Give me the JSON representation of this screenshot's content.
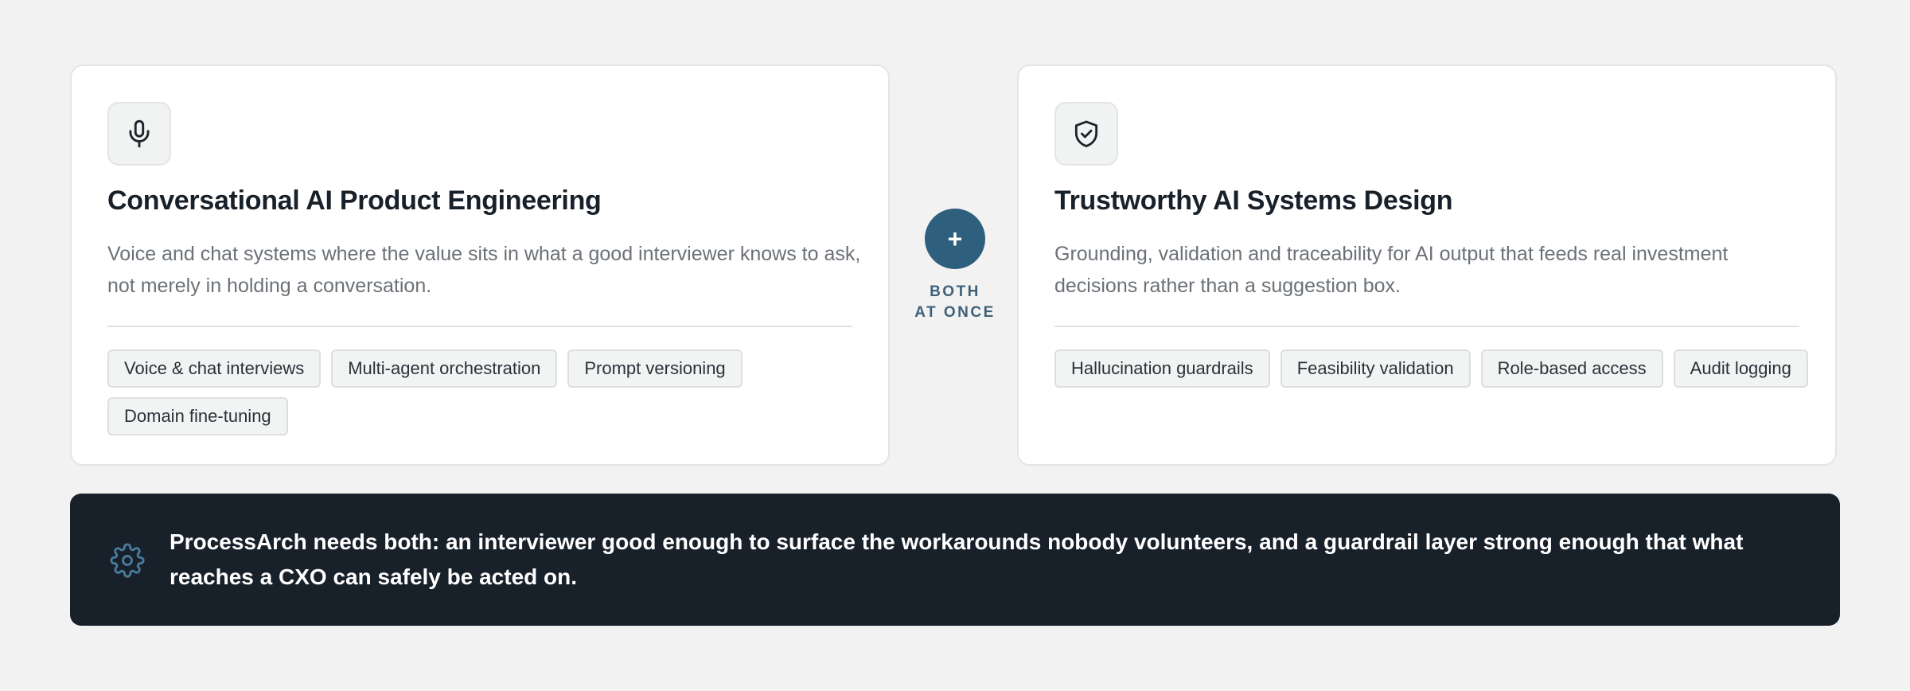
{
  "cards": [
    {
      "icon": "microphone-icon",
      "title": "Conversational AI Product Engineering",
      "description": "Voice and chat systems where the value sits in what a good interviewer knows to ask, not merely in holding a conversation.",
      "tags": [
        "Voice & chat interviews",
        "Multi-agent orchestration",
        "Prompt versioning",
        "Domain fine-tuning"
      ]
    },
    {
      "icon": "shield-check-icon",
      "title": "Trustworthy AI Systems Design",
      "description": "Grounding, validation and traceability for AI output that feeds real investment decisions rather than a suggestion box.",
      "tags": [
        "Hallucination guardrails",
        "Feasibility validation",
        "Role-based access",
        "Audit logging"
      ]
    }
  ],
  "connector": {
    "symbol": "+",
    "label_line1": "BOTH",
    "label_line2": "AT ONCE"
  },
  "banner": {
    "icon": "gear-icon",
    "text": "ProcessArch needs both: an interviewer good enough to surface the workarounds nobody volunteers, and a guardrail layer strong enough that what reaches a CXO can safely be acted on."
  },
  "colors": {
    "background": "#f1f2f1",
    "accent": "#2e5f7d",
    "banner_bg": "#18202a",
    "banner_icon": "#4a7a99"
  }
}
